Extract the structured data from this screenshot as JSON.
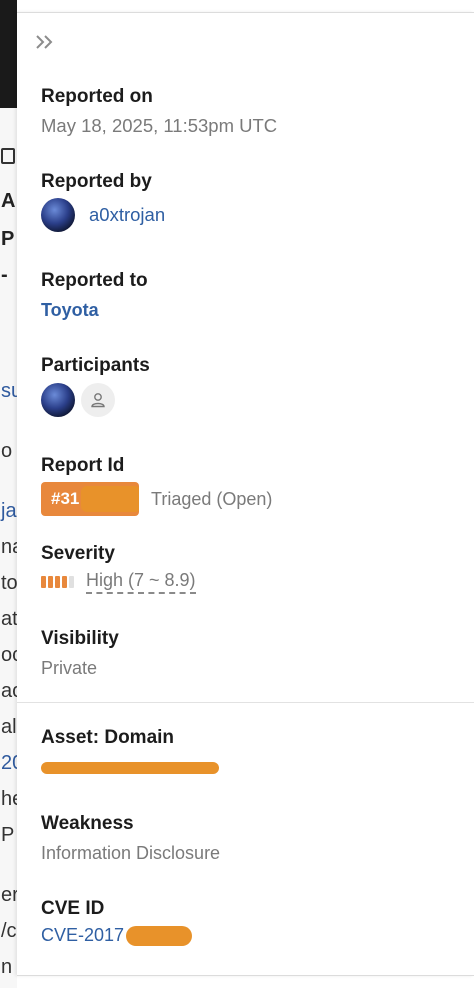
{
  "panel": {
    "reported_on": {
      "label": "Reported on",
      "value": "May 18, 2025, 11:53pm UTC"
    },
    "reported_by": {
      "label": "Reported by",
      "value": "a0xtrojan"
    },
    "reported_to": {
      "label": "Reported to",
      "value": "Toyota"
    },
    "participants": {
      "label": "Participants"
    },
    "report_id": {
      "label": "Report Id",
      "id_prefix": "#31",
      "status": "Triaged (Open)"
    },
    "severity": {
      "label": "Severity",
      "value": "High (7 ~ 8.9)",
      "level": 4,
      "max": 5
    },
    "visibility": {
      "label": "Visibility",
      "value": "Private"
    },
    "asset": {
      "label": "Asset: Domain"
    },
    "weakness": {
      "label": "Weakness",
      "value": "Information Disclosure"
    },
    "cve": {
      "label": "CVE ID",
      "value_prefix": "CVE-2017"
    }
  },
  "background": {
    "fragments": [
      "A",
      "P",
      "-",
      "su",
      "o",
      "ja",
      "na",
      "to",
      "at",
      "oc",
      "ac",
      "al",
      "20",
      "he",
      "P",
      "er",
      "/c",
      "n"
    ]
  },
  "colors": {
    "accent": "#e8883c",
    "link": "#2f5fa3",
    "redaction": "#e8922a"
  }
}
